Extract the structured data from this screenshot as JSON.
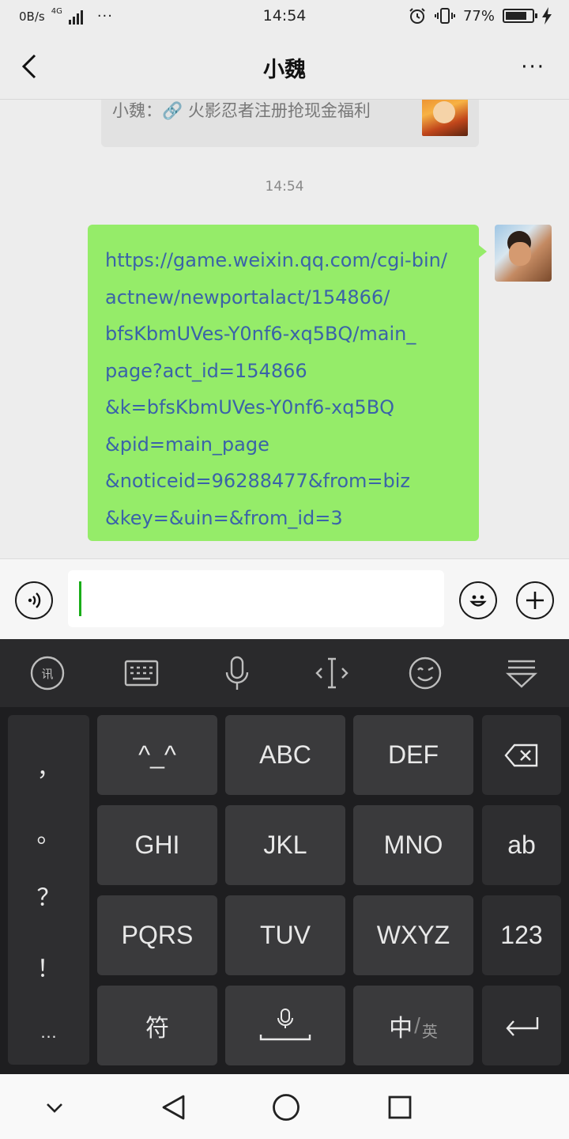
{
  "status_bar": {
    "net_speed": "0B/s",
    "network_type": "4G",
    "more": "···",
    "time": "14:54",
    "battery": "77%",
    "icons": [
      "signal-icon",
      "alarm-icon",
      "vibrate-icon",
      "battery-icon",
      "charging-icon"
    ]
  },
  "header": {
    "title": "小魏",
    "back_icon": "chevron-left-icon",
    "more_label": "···"
  },
  "chat": {
    "card_text": "小魏：🔗 火影忍者注册抢现金福利",
    "timestamp": "14:54",
    "message_lines": [
      "https://game.weixin.qq.com/cgi-bin/",
      "actnew/newportalact/154866/",
      "bfsKbmUVes-Y0nf6-xq5BQ/main_",
      "page?act_id=154866",
      "&k=bfsKbmUVes-Y0nf6-xq5BQ",
      "&pid=main_page",
      "&noticeid=96288477&from=biz",
      "&key=&uin=&from_id=3"
    ],
    "bubble_color": "#95ec69",
    "link_color": "#3a63a8"
  },
  "input_bar": {
    "value": "",
    "caret_color": "#1aad19"
  },
  "keyboard": {
    "toolbar_icons": [
      "ifly-logo-icon",
      "keyboard-icon",
      "microphone-icon",
      "cursor-icon",
      "emoji-icon",
      "collapse-keyboard-icon"
    ],
    "punctuation": [
      "，",
      "。",
      "？",
      "！",
      "…"
    ],
    "row1": [
      "^_^",
      "ABC",
      "DEF"
    ],
    "row2": [
      "GHI",
      "JKL",
      "MNO"
    ],
    "row3": [
      "PQRS",
      "TUV",
      "WXYZ"
    ],
    "row4": [
      "符",
      "中",
      "英"
    ],
    "side": [
      "ab",
      "123"
    ]
  },
  "nav_bar": {
    "icons": [
      "chevron-down-icon",
      "back-triangle-icon",
      "home-circle-icon",
      "recents-square-icon"
    ]
  }
}
